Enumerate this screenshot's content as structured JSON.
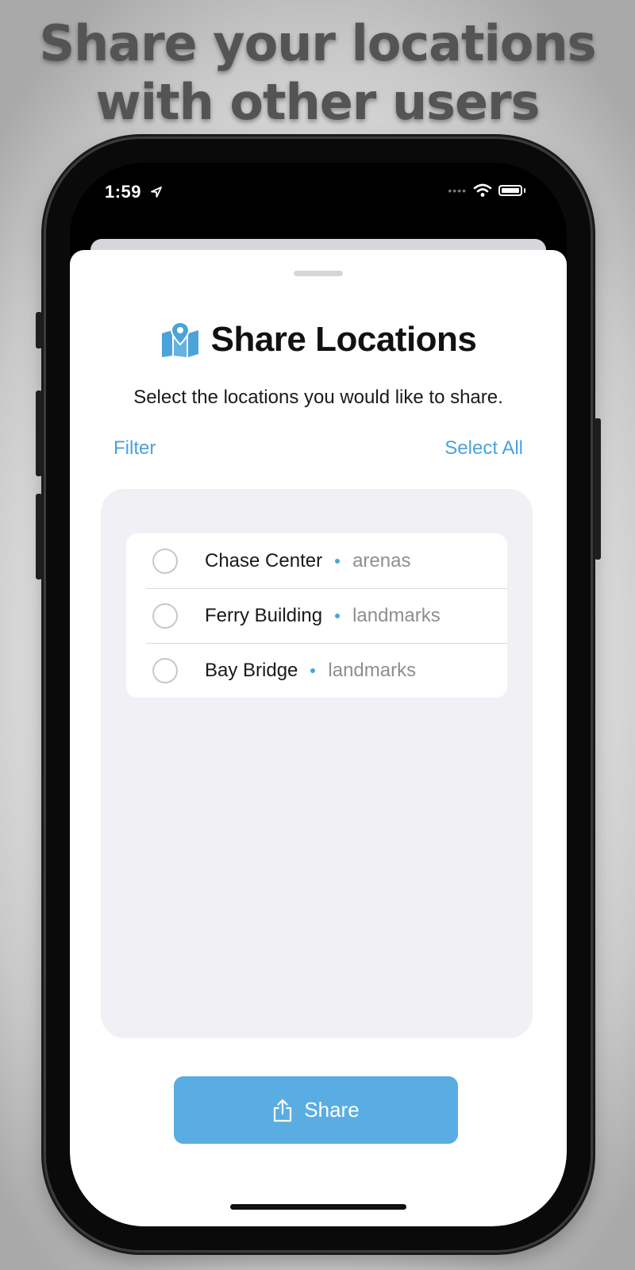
{
  "headline": {
    "line1": "Share your locations",
    "line2": "with other users"
  },
  "status_bar": {
    "time": "1:59"
  },
  "sheet": {
    "title": "Share Locations",
    "subtitle": "Select the locations you would like to share.",
    "filter_label": "Filter",
    "select_all_label": "Select All",
    "locations": [
      {
        "name": "Chase Center",
        "category": "arenas",
        "selected": false
      },
      {
        "name": "Ferry Building",
        "category": "landmarks",
        "selected": false
      },
      {
        "name": "Bay Bridge",
        "category": "landmarks",
        "selected": false
      }
    ],
    "share_label": "Share"
  },
  "colors": {
    "accent": "#4aa3db",
    "button": "#5aade2",
    "headline": "#545454"
  },
  "icons": {
    "title_icon": "map-pin-icon",
    "share_icon": "share-icon",
    "location_status": "location-arrow-icon",
    "wifi": "wifi-icon",
    "battery": "battery-icon"
  }
}
